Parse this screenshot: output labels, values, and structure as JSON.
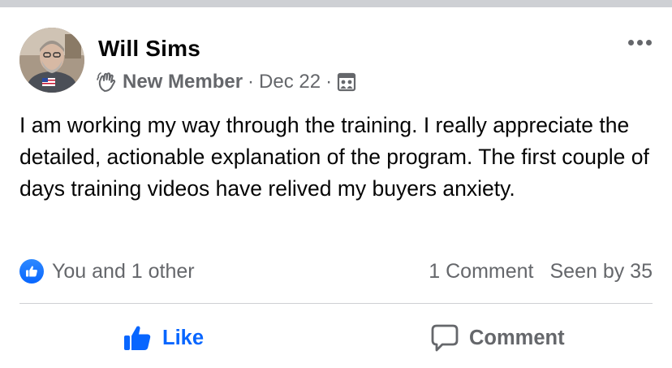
{
  "post": {
    "author": "Will Sims",
    "badge": "New Member",
    "separator": "·",
    "date": "Dec 22",
    "audience_icon": "group-audience-icon",
    "text": "I am working my way through the training. I really appreciate the detailed, actionable explanation of the program. The first couple of days training videos have relived my buyers anxiety."
  },
  "reactions": {
    "icon": "like-reaction-icon",
    "summary": "You and 1 other",
    "comments": "1 Comment",
    "seen": "Seen by 35"
  },
  "actions": {
    "like": "Like",
    "comment": "Comment"
  },
  "colors": {
    "accent": "#0866ff",
    "secondary_text": "#65676b",
    "divider": "#ced0d4"
  }
}
